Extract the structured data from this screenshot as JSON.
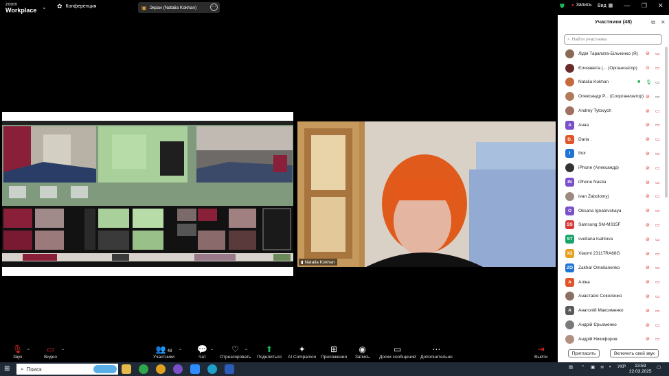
{
  "app": {
    "brand_line1": "zoom",
    "brand_line2": "Workplace",
    "meeting_label": "Конференция"
  },
  "share_tab": {
    "label": "Экран (Natalia  Kokhan)"
  },
  "title_right": {
    "record": "Запись",
    "view": "Вид"
  },
  "video": {
    "name": "Natalia  Kokhan"
  },
  "panel": {
    "title": "Участники (48)",
    "search_placeholder": "Найти участника",
    "participants": [
      {
        "name": "Лідія Тарапата-Більченко (Я)",
        "avatar": "photo",
        "color": "#8a6a55",
        "mic": "muted",
        "cam": "off"
      },
      {
        "name": "Єлизавета (... (Организатор)",
        "avatar": "photo",
        "color": "#6a2b2b",
        "mic": "rec",
        "cam": "off"
      },
      {
        "name": "Natalia  Kokhan",
        "avatar": "photo",
        "color": "#c56a3c",
        "mic": "on",
        "cam": "on"
      },
      {
        "name": "Олександр P... (Соорганизатор)",
        "avatar": "photo",
        "color": "#b07b5a",
        "mic": "muted",
        "cam": "on"
      },
      {
        "name": "Andrey Tytovych",
        "avatar": "photo",
        "color": "#a07060",
        "mic": "muted",
        "cam": "off"
      },
      {
        "name": "Анна",
        "avatar": "А",
        "color": "#7a4fc9",
        "mic": "muted",
        "cam": "off"
      },
      {
        "name": "Daria .",
        "avatar": "D.",
        "color": "#e0542a",
        "mic": "muted",
        "cam": "off"
      },
      {
        "name": "Ihor",
        "avatar": "I",
        "color": "#1f74d6",
        "mic": "muted",
        "cam": "off"
      },
      {
        "name": "iPhone (Александр)",
        "avatar": "photo",
        "color": "#333333",
        "mic": "muted",
        "cam": "off"
      },
      {
        "name": "iPhone Nastia",
        "avatar": "IN",
        "color": "#7a4fc9",
        "mic": "muted",
        "cam": "off"
      },
      {
        "name": "Ivan Zabolotnyj",
        "avatar": "photo",
        "color": "#9a8a80",
        "mic": "muted",
        "cam": "off"
      },
      {
        "name": "Oksana Ignatovskaya",
        "avatar": "O",
        "color": "#7a4fc9",
        "mic": "muted",
        "cam": "off"
      },
      {
        "name": "Samsung SM-M315F",
        "avatar": "SS",
        "color": "#d63a3a",
        "mic": "muted",
        "cam": "off"
      },
      {
        "name": "svetlana tsahlova",
        "avatar": "ST",
        "color": "#18a36a",
        "mic": "muted",
        "cam": "off"
      },
      {
        "name": "Xiaomi 23117RA68G",
        "avatar": "X2",
        "color": "#e6a020",
        "mic": "muted",
        "cam": "off"
      },
      {
        "name": "Zakhar Omelianenko",
        "avatar": "ZO",
        "color": "#1f74d6",
        "mic": "muted",
        "cam": "off"
      },
      {
        "name": "Аліна",
        "avatar": "А",
        "color": "#e0542a",
        "mic": "muted",
        "cam": "off"
      },
      {
        "name": "Анастасія Соколенко",
        "avatar": "photo",
        "color": "#8a7060",
        "mic": "muted",
        "cam": "off"
      },
      {
        "name": "Анатолій Максименко",
        "avatar": "А",
        "color": "#5a5a5a",
        "mic": "muted",
        "cam": "off"
      },
      {
        "name": "Андрій Єрьоменко",
        "avatar": "photo",
        "color": "#7a7a7a",
        "mic": "muted",
        "cam": "off"
      },
      {
        "name": "Андрій Никифоров",
        "avatar": "photo",
        "color": "#b09080",
        "mic": "muted",
        "cam": "off"
      }
    ],
    "invite": "Пригласить",
    "unmute_self": "Включить свой звук"
  },
  "toolbar": {
    "audio": "Звук",
    "video": "Видео",
    "participants": "Участники",
    "participants_count": "48",
    "chat": "Чат",
    "react": "Отреагировать",
    "share": "Поделиться",
    "ai": "AI Companion",
    "apps": "Приложения",
    "record": "Запись",
    "whiteboards": "Доски сообщений",
    "more": "Дополнительно",
    "leave": "Выйти"
  },
  "taskbar": {
    "search": "Поиск",
    "lang": "УКР",
    "time": "13:59",
    "date": "22.03.2025"
  }
}
